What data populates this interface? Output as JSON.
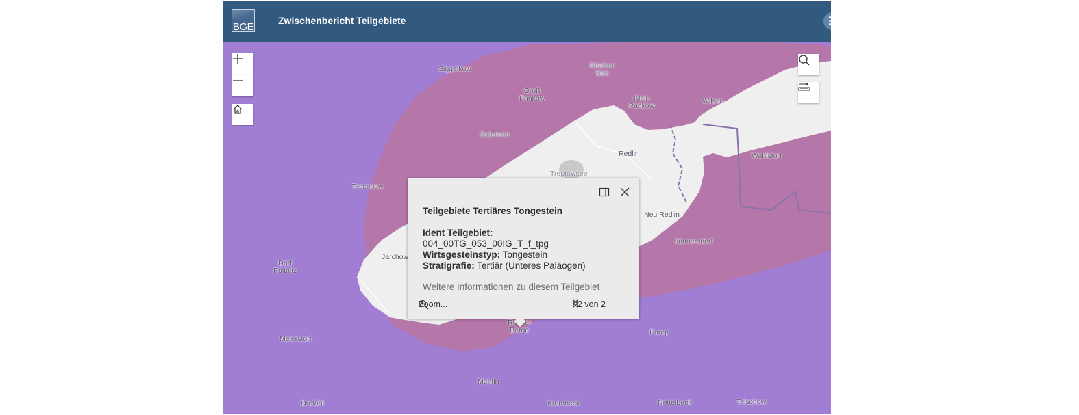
{
  "header": {
    "logo_text": "BGE",
    "title": "Zwischenbericht Teilgebiete"
  },
  "map": {
    "colors": {
      "outer_area": "#a17ed4",
      "subarea": "#b577aa",
      "excluded_area": "#efefef",
      "boundary": "#8a73a8"
    },
    "places": [
      {
        "name": "Siggelkow"
      },
      {
        "name": "Blanker\nSee"
      },
      {
        "name": "Groß\nPankow"
      },
      {
        "name": "Klein\nPankow"
      },
      {
        "name": "Wilsen"
      },
      {
        "name": "Sabelsee"
      },
      {
        "name": "Redlin"
      },
      {
        "name": "Wahlstorf"
      },
      {
        "name": "Treptowsee"
      },
      {
        "name": "Tessenow"
      },
      {
        "name": "Neu Redlin"
      },
      {
        "name": "Jännersdorf"
      },
      {
        "name": "Dorf\nPoltnitz"
      },
      {
        "name": "Jarchow"
      },
      {
        "name": "Ruhner\nBerge"
      },
      {
        "name": "Porep"
      },
      {
        "name": "Meierstorf"
      },
      {
        "name": "Mentin"
      },
      {
        "name": "Drefahl"
      },
      {
        "name": "Krumbeck"
      },
      {
        "name": "Nettelbeck"
      },
      {
        "name": "Telschow"
      }
    ]
  },
  "controls": {
    "zoom_in": "zoom-in",
    "zoom_out": "zoom-out",
    "home": "home-icon",
    "search": "search-icon",
    "measure": "measure-icon"
  },
  "popup": {
    "title": "Teilgebiete Tertiäres Tongestein",
    "ident_label": "Ident Teilgebiet:",
    "ident_value": "004_00TG_053_00IG_T_f_tpg",
    "wirt_label": "Wirtsgesteinstyp:",
    "wirt_value": " Tongestein",
    "strat_label": "Stratigrafie:",
    "strat_value": " Tertiär (Unteres Paläogen)",
    "more_info": "Weitere Informationen zu diesem Teilgebiet",
    "zoom_label": "Zoom...",
    "pager": "2 von 2"
  }
}
